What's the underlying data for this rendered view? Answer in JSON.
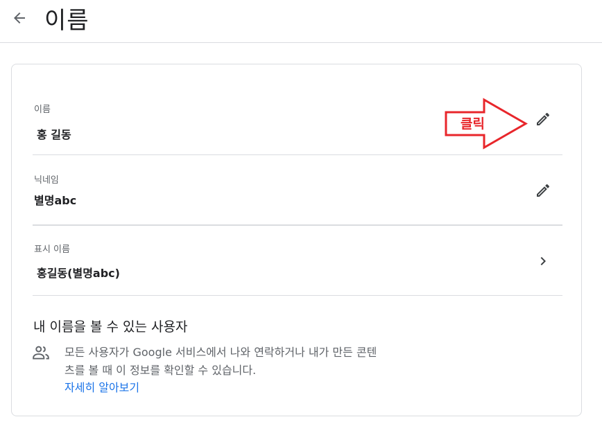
{
  "header": {
    "back_icon": "arrow-back-icon",
    "title": "이름"
  },
  "fields": [
    {
      "label": "이름",
      "value": "홍 길동",
      "action_icon": "pencil-icon"
    },
    {
      "label": "닉네임",
      "value": "별명abc",
      "action_icon": "pencil-icon"
    },
    {
      "label": "표시 이름",
      "value": "홍길동(별명abc)",
      "action_icon": "chevron-right-icon"
    }
  ],
  "visibility": {
    "title": "내 이름을 볼 수 있는 사용자",
    "icon": "people-icon",
    "description": "모든 사용자가 Google 서비스에서 나와 연락하거나 내가 만든 콘텐츠를 볼 때 이 정보를 확인할 수 있습니다.",
    "learn_more": "자세히 알아보기"
  },
  "annotation": {
    "label": "클릭",
    "color": "#e8262b"
  },
  "colors": {
    "link": "#1a73e8",
    "divider": "#dadce0",
    "text_secondary": "#5f6368"
  }
}
